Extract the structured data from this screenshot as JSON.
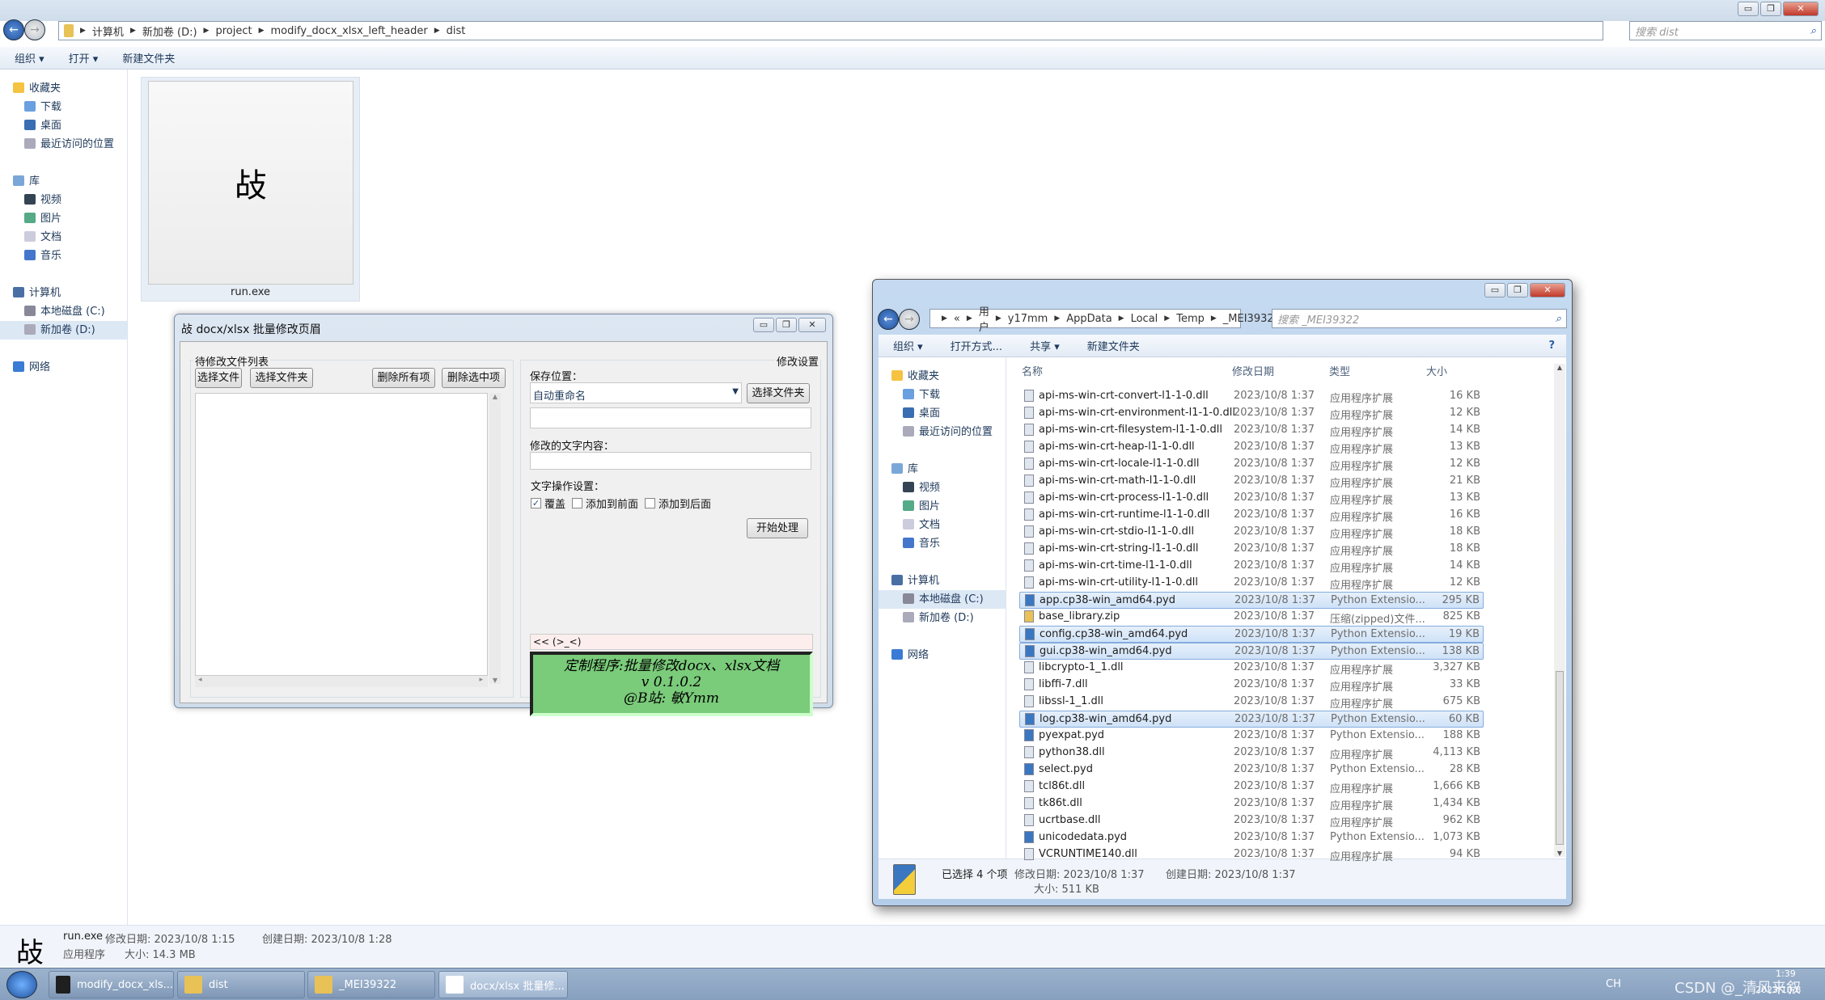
{
  "main": {
    "breadcrumb": [
      "计算机",
      "新加卷 (D:)",
      "project",
      "modify_docx_xlsx_left_header",
      "dist"
    ],
    "search_placeholder": "搜索 dist",
    "toolbar": {
      "organize": "组织 ▾",
      "open": "打开 ▾",
      "new_folder": "新建文件夹"
    },
    "nav": {
      "favorites": "收藏夹",
      "downloads": "下载",
      "desktop": "桌面",
      "recent": "最近访问的位置",
      "libraries": "库",
      "videos": "视频",
      "pictures": "图片",
      "documents": "文档",
      "music": "音乐",
      "computer": "计算机",
      "drive_c": "本地磁盘 (C:)",
      "drive_d": "新加卷 (D:)",
      "network": "网络"
    },
    "file": {
      "name": "run.exe",
      "icon_glyph": "敁"
    },
    "status": {
      "name": "run.exe",
      "modified": "修改日期: 2023/10/8 1:15",
      "created": "创建日期: 2023/10/8 1:28",
      "type": "应用程序",
      "size": "大小: 14.3 MB"
    }
  },
  "app": {
    "title": "docx/xlsx 批量修改页眉",
    "list_group": "待修改文件列表",
    "select_file": "选择文件",
    "select_folder": "选择文件夹",
    "delete_all": "删除所有项",
    "delete_selected": "删除选中项",
    "settings_group": "修改设置",
    "save_location_label": "保存位置：",
    "save_location_value": "自动重命名",
    "choose_folder": "选择文件夹",
    "save_path_value": "",
    "text_label": "修改的文字内容：",
    "text_value": "",
    "op_label": "文字操作设置：",
    "options": [
      {
        "label": "覆盖",
        "checked": true
      },
      {
        "label": "添加到前面",
        "checked": false
      },
      {
        "label": "添加到后面",
        "checked": false
      }
    ],
    "start": "开始处理",
    "log": "<< (>_<)",
    "banner": [
      "定制程序:批量修改docx、xlsx文档",
      "v 0.1.0.2",
      "@B站: 敏Ymm"
    ],
    "banner_color": "#7acb7a"
  },
  "explorer2": {
    "breadcrumb": [
      "«",
      "用户",
      "y17mm",
      "AppData",
      "Local",
      "Temp",
      "_MEI39322"
    ],
    "search_placeholder": "搜索 _MEI39322",
    "toolbar": {
      "organize": "组织 ▾",
      "open_with": "打开方式...",
      "share": "共享 ▾",
      "new_folder": "新建文件夹"
    },
    "columns": [
      "名称",
      "修改日期",
      "类型",
      "大小"
    ],
    "files": [
      [
        "api-ms-win-crt-convert-l1-1-0.dll",
        "2023/10/8 1:37",
        "应用程序扩展",
        "16 KB",
        false
      ],
      [
        "api-ms-win-crt-environment-l1-1-0.dll",
        "2023/10/8 1:37",
        "应用程序扩展",
        "12 KB",
        false
      ],
      [
        "api-ms-win-crt-filesystem-l1-1-0.dll",
        "2023/10/8 1:37",
        "应用程序扩展",
        "14 KB",
        false
      ],
      [
        "api-ms-win-crt-heap-l1-1-0.dll",
        "2023/10/8 1:37",
        "应用程序扩展",
        "13 KB",
        false
      ],
      [
        "api-ms-win-crt-locale-l1-1-0.dll",
        "2023/10/8 1:37",
        "应用程序扩展",
        "12 KB",
        false
      ],
      [
        "api-ms-win-crt-math-l1-1-0.dll",
        "2023/10/8 1:37",
        "应用程序扩展",
        "21 KB",
        false
      ],
      [
        "api-ms-win-crt-process-l1-1-0.dll",
        "2023/10/8 1:37",
        "应用程序扩展",
        "13 KB",
        false
      ],
      [
        "api-ms-win-crt-runtime-l1-1-0.dll",
        "2023/10/8 1:37",
        "应用程序扩展",
        "16 KB",
        false
      ],
      [
        "api-ms-win-crt-stdio-l1-1-0.dll",
        "2023/10/8 1:37",
        "应用程序扩展",
        "18 KB",
        false
      ],
      [
        "api-ms-win-crt-string-l1-1-0.dll",
        "2023/10/8 1:37",
        "应用程序扩展",
        "18 KB",
        false
      ],
      [
        "api-ms-win-crt-time-l1-1-0.dll",
        "2023/10/8 1:37",
        "应用程序扩展",
        "14 KB",
        false
      ],
      [
        "api-ms-win-crt-utility-l1-1-0.dll",
        "2023/10/8 1:37",
        "应用程序扩展",
        "12 KB",
        false
      ],
      [
        "app.cp38-win_amd64.pyd",
        "2023/10/8 1:37",
        "Python Extensio...",
        "295 KB",
        true
      ],
      [
        "base_library.zip",
        "2023/10/8 1:37",
        "压缩(zipped)文件...",
        "825 KB",
        false
      ],
      [
        "config.cp38-win_amd64.pyd",
        "2023/10/8 1:37",
        "Python Extensio...",
        "19 KB",
        true
      ],
      [
        "gui.cp38-win_amd64.pyd",
        "2023/10/8 1:37",
        "Python Extensio...",
        "138 KB",
        true
      ],
      [
        "libcrypto-1_1.dll",
        "2023/10/8 1:37",
        "应用程序扩展",
        "3,327 KB",
        false
      ],
      [
        "libffi-7.dll",
        "2023/10/8 1:37",
        "应用程序扩展",
        "33 KB",
        false
      ],
      [
        "libssl-1_1.dll",
        "2023/10/8 1:37",
        "应用程序扩展",
        "675 KB",
        false
      ],
      [
        "log.cp38-win_amd64.pyd",
        "2023/10/8 1:37",
        "Python Extensio...",
        "60 KB",
        true
      ],
      [
        "pyexpat.pyd",
        "2023/10/8 1:37",
        "Python Extensio...",
        "188 KB",
        false
      ],
      [
        "python38.dll",
        "2023/10/8 1:37",
        "应用程序扩展",
        "4,113 KB",
        false
      ],
      [
        "select.pyd",
        "2023/10/8 1:37",
        "Python Extensio...",
        "28 KB",
        false
      ],
      [
        "tcl86t.dll",
        "2023/10/8 1:37",
        "应用程序扩展",
        "1,666 KB",
        false
      ],
      [
        "tk86t.dll",
        "2023/10/8 1:37",
        "应用程序扩展",
        "1,434 KB",
        false
      ],
      [
        "ucrtbase.dll",
        "2023/10/8 1:37",
        "应用程序扩展",
        "962 KB",
        false
      ],
      [
        "unicodedata.pyd",
        "2023/10/8 1:37",
        "Python Extensio...",
        "1,073 KB",
        false
      ],
      [
        "VCRUNTIME140.dll",
        "2023/10/8 1:37",
        "应用程序扩展",
        "94 KB",
        false
      ]
    ],
    "status": {
      "selected": "已选择 4 个项",
      "modified": "修改日期: 2023/10/8 1:37",
      "created": "创建日期: 2023/10/8 1:37",
      "size": "大小: 511 KB"
    }
  },
  "taskbar": {
    "items": [
      "modify_docx_xls...",
      "dist",
      "_MEI39322",
      "docx/xlsx 批量修..."
    ],
    "tray": "CH",
    "time": "1:39",
    "date": "2023/10/8",
    "watermark": "CSDN @_清风来叙"
  }
}
